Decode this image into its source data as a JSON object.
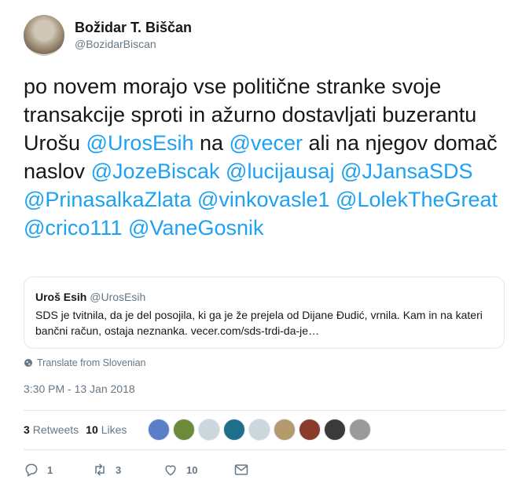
{
  "author": {
    "display_name": "Božidar T. Biščan",
    "handle": "@BozidarBiscan"
  },
  "tweet": {
    "parts": [
      {
        "text": "po novem morajo vse politične stranke svoje transakcije sproti in ažurno dostavljati buzerantu Urošu ",
        "mention": false
      },
      {
        "text": "@UrosEsih",
        "mention": true
      },
      {
        "text": "  na ",
        "mention": false
      },
      {
        "text": "@vecer",
        "mention": true
      },
      {
        "text": " ali na njegov domač naslov ",
        "mention": false
      },
      {
        "text": "@JozeBiscak",
        "mention": true
      },
      {
        "text": " ",
        "mention": false
      },
      {
        "text": "@lucijausaj",
        "mention": true
      },
      {
        "text": "   ",
        "mention": false
      },
      {
        "text": "@JJansaSDS",
        "mention": true
      },
      {
        "text": "  ",
        "mention": false
      },
      {
        "text": "@PrinasalkaZlata",
        "mention": true
      },
      {
        "text": " ",
        "mention": false
      },
      {
        "text": "@vinkovasle1",
        "mention": true
      },
      {
        "text": " ",
        "mention": false
      },
      {
        "text": "@LolekTheGreat",
        "mention": true
      },
      {
        "text": " ",
        "mention": false
      },
      {
        "text": "@crico111",
        "mention": true
      },
      {
        "text": " ",
        "mention": false
      },
      {
        "text": "@VaneGosnik",
        "mention": true
      }
    ]
  },
  "quote": {
    "name": "Uroš Esih",
    "handle": "@UrosEsih",
    "text": "SDS je tvitnila, da je del posojila, ki ga je že prejela od Dijane Đudić, vrnila. Kam in na kateri bančni račun, ostaja neznanka. vecer.com/sds-trdi-da-je…"
  },
  "translate_label": "Translate from Slovenian",
  "timestamp": "3:30 PM - 13 Jan 2018",
  "stats": {
    "retweets_count": "3",
    "retweets_label": "Retweets",
    "likes_count": "10",
    "likes_label": "Likes"
  },
  "liker_avatars": [
    {
      "name": "liker-avatar-1",
      "color": "#5b7fc7"
    },
    {
      "name": "liker-avatar-2",
      "color": "#6d8a3a"
    },
    {
      "name": "liker-avatar-3",
      "color": "#ccd6dd"
    },
    {
      "name": "liker-avatar-4",
      "color": "#1f6f8b"
    },
    {
      "name": "liker-avatar-5",
      "color": "#ccd6dd"
    },
    {
      "name": "liker-avatar-6",
      "color": "#b59a6d"
    },
    {
      "name": "liker-avatar-7",
      "color": "#8a3b2c"
    },
    {
      "name": "liker-avatar-8",
      "color": "#3a3a3a"
    },
    {
      "name": "liker-avatar-9",
      "color": "#9a9a9a"
    }
  ],
  "actions": {
    "reply_count": "1",
    "retweet_count": "3",
    "like_count": "10"
  },
  "colors": {
    "accent": "#1da1f2",
    "muted": "#657786",
    "border": "#e1e8ed"
  }
}
